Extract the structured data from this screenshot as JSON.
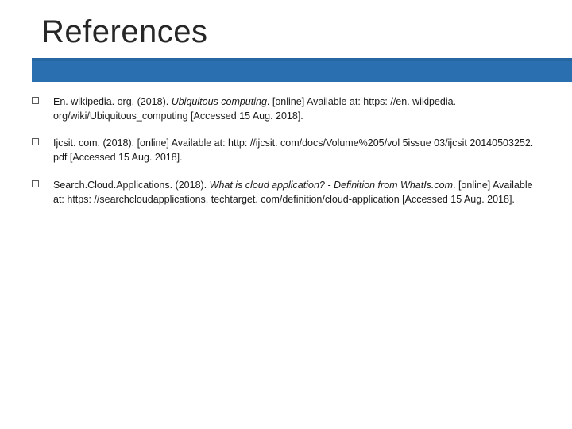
{
  "accent_color": "#2a6fb0",
  "title": "References",
  "references": [
    {
      "prefix": "En. wikipedia. org. (2018). ",
      "italic": "Ubiquitous computing",
      "suffix": ". [online] Available at: https: //en. wikipedia. org/wiki/Ubiquitous_computing [Accessed 15 Aug. 2018]."
    },
    {
      "prefix": "Ijcsit. com. (2018). [online] Available at: http: //ijcsit. com/docs/Volume%205/vol 5issue 03/ijcsit 20140503252. pdf [Accessed 15 Aug. 2018].",
      "italic": "",
      "suffix": ""
    },
    {
      "prefix": "Search.Cloud.Applications. (2018). ",
      "italic": "What is cloud application? - Definition from WhatIs.com",
      "suffix": ". [online] Available at: https: //searchcloudapplications. techtarget. com/definition/cloud-application [Accessed 15 Aug. 2018]."
    }
  ]
}
